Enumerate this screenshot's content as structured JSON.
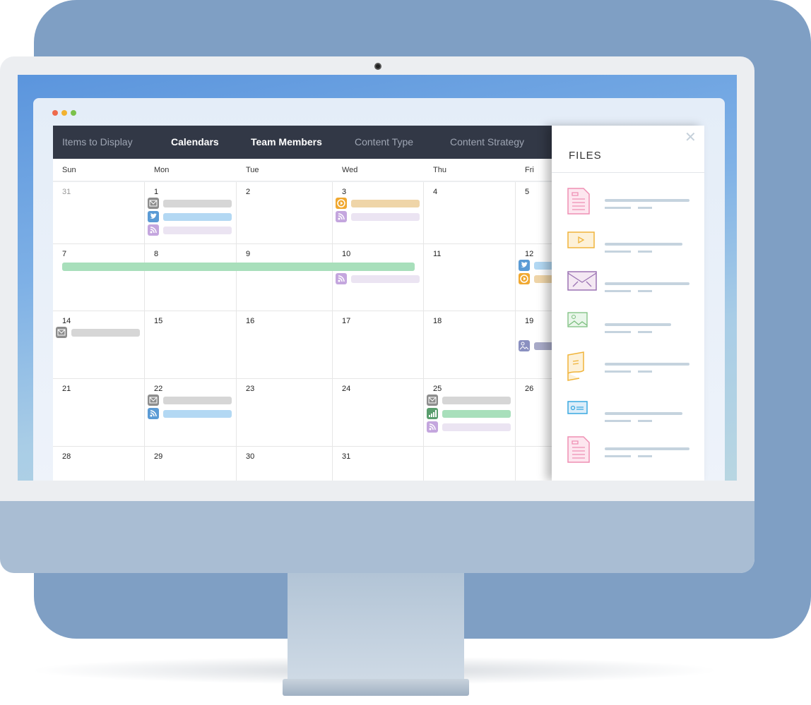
{
  "window": {
    "dots": [
      "#ee6a4c",
      "#f2b230",
      "#7bc14b"
    ]
  },
  "nav": {
    "items": [
      {
        "label": "Items to Display",
        "active": false
      },
      {
        "label": "Calendars",
        "active": true
      },
      {
        "label": "Team Members",
        "active": true
      },
      {
        "label": "Content Type",
        "active": false
      },
      {
        "label": "Content Strategy",
        "active": false
      }
    ]
  },
  "days": [
    "Sun",
    "Mon",
    "Tue",
    "Wed",
    "Thu",
    "Fri"
  ],
  "event_types": {
    "email": {
      "icon": "email-icon",
      "color": "#8d8d8d",
      "bar": "#d6d6d6"
    },
    "twitter": {
      "icon": "twitter-icon",
      "color": "#5b9bd5",
      "bar": "#b3d8f3"
    },
    "rss": {
      "icon": "rss-icon",
      "color": "#c4a6de",
      "bar": "#ebe4f2"
    },
    "rss-blue": {
      "icon": "rss-icon",
      "color": "#5b9bd5",
      "bar": "#b3d8f3"
    },
    "video": {
      "icon": "play-icon",
      "color": "#f0a830",
      "bar": "#efd5a8"
    },
    "image": {
      "icon": "image-icon",
      "color": "#8a90c0",
      "bar": "#a8aac8"
    },
    "chart": {
      "icon": "bar-chart-icon",
      "color": "#5a9e6e",
      "bar": "#a8dfbb"
    }
  },
  "weeks": [
    {
      "days": [
        {
          "n": "31",
          "muted": true,
          "ev": []
        },
        {
          "n": "1",
          "ev": [
            "email",
            "twitter",
            "rss"
          ]
        },
        {
          "n": "2",
          "ev": []
        },
        {
          "n": "3",
          "ev": [
            "video",
            "rss"
          ]
        },
        {
          "n": "4",
          "ev": []
        },
        {
          "n": "5",
          "ev": []
        }
      ]
    },
    {
      "days": [
        {
          "n": "7",
          "ev": []
        },
        {
          "n": "8",
          "ev": []
        },
        {
          "n": "9",
          "ev": []
        },
        {
          "n": "10",
          "ev": [
            null,
            "rss"
          ]
        },
        {
          "n": "11",
          "ev": []
        },
        {
          "n": "12",
          "ev": [
            "twitter",
            "video"
          ]
        }
      ],
      "span": {
        "from": 0,
        "to": 3,
        "color": "#a8dfbb"
      }
    },
    {
      "days": [
        {
          "n": "14",
          "ev": [
            "email"
          ]
        },
        {
          "n": "15",
          "ev": []
        },
        {
          "n": "16",
          "ev": []
        },
        {
          "n": "17",
          "ev": []
        },
        {
          "n": "18",
          "ev": []
        },
        {
          "n": "19",
          "ev": [
            null,
            "image"
          ]
        }
      ],
      "span": {
        "from": 2,
        "to": 6,
        "color": "#b3d8f3"
      }
    },
    {
      "days": [
        {
          "n": "21",
          "ev": []
        },
        {
          "n": "22",
          "ev": [
            "email",
            "rss-blue"
          ]
        },
        {
          "n": "23",
          "ev": []
        },
        {
          "n": "24",
          "ev": []
        },
        {
          "n": "25",
          "ev": [
            "email",
            "chart",
            "rss"
          ]
        },
        {
          "n": "26",
          "ev": []
        }
      ]
    },
    {
      "days": [
        {
          "n": "28",
          "ev": []
        },
        {
          "n": "29",
          "ev": []
        },
        {
          "n": "30",
          "ev": []
        },
        {
          "n": "31",
          "ev": []
        },
        {
          "n": "",
          "ev": []
        },
        {
          "n": "",
          "ev": []
        }
      ]
    }
  ],
  "files": {
    "title": "FILES",
    "close_icon": "close-icon",
    "items": [
      {
        "icon": "document-icon",
        "color": "#ef8fb4"
      },
      {
        "icon": "video-file-icon",
        "color": "#f0b43a"
      },
      {
        "icon": "envelope-icon",
        "color": "#9b73b3"
      },
      {
        "icon": "image-file-icon",
        "color": "#7cbf7f"
      },
      {
        "icon": "note-icon",
        "color": "#f0b43a"
      },
      {
        "icon": "id-card-icon",
        "color": "#3aa9e0"
      },
      {
        "icon": "document-icon",
        "color": "#ef8fb4"
      }
    ]
  }
}
